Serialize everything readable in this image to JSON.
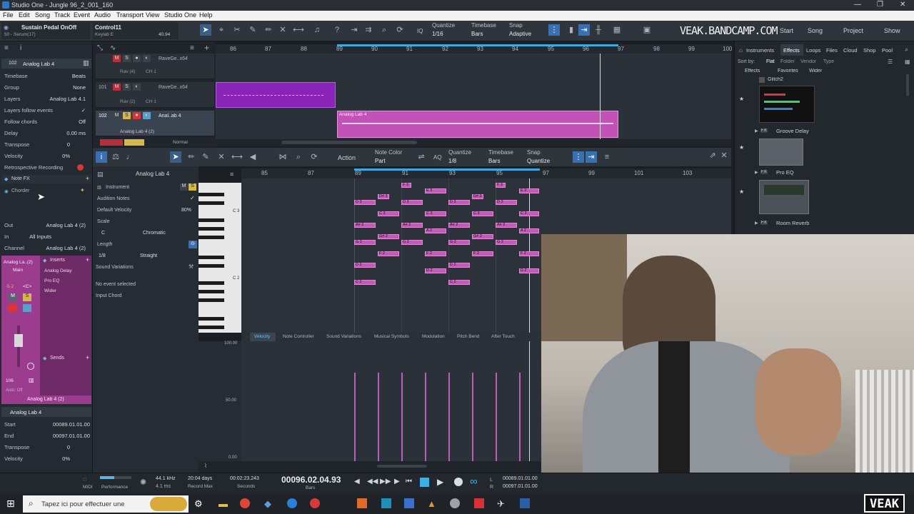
{
  "titlebar": {
    "title": "Studio One - Jungle 96_2_001_160",
    "minimize": "—",
    "maximize": "❐",
    "close": "✕"
  },
  "menu": [
    "File",
    "Edit",
    "Song",
    "Track",
    "Event",
    "Audio",
    "Transport",
    "View",
    "Studio One",
    "Help"
  ],
  "toolbar": {
    "control_a_title": "Sustain Pedal OnOff",
    "control_a_sub": "50 - Serum(17)",
    "control_b_title": "Control11",
    "control_b_sub": "Keylab E",
    "control_b_value": "40.94",
    "quantize_label": "Quantize",
    "quantize_value": "1/16",
    "timebase_label": "Timebase",
    "timebase_value": "Bars",
    "snap_label": "Snap",
    "snap_value": "Adaptive",
    "iq_label": "IQ",
    "brand": "VEAK.BANDCAMP.COM",
    "nav_start": "Start",
    "nav_song": "Song",
    "nav_project": "Project",
    "nav_show": "Show"
  },
  "inspector": {
    "track_number": "102",
    "track_name": "Analog Lab 4",
    "rows": [
      {
        "k": "Timebase",
        "v": "Beats"
      },
      {
        "k": "Group",
        "v": "None"
      },
      {
        "k": "Layers",
        "v": "Analog Lab 4.1"
      },
      {
        "k": "Layers follow events",
        "v": "✓"
      },
      {
        "k": "Follow chords",
        "v": "Off"
      },
      {
        "k": "Delay",
        "v": "0.00 ms"
      },
      {
        "k": "Transpose",
        "v": "0"
      },
      {
        "k": "Velocity",
        "v": "0%"
      },
      {
        "k": "Retrospective Recording",
        "v": ""
      }
    ],
    "note_fx_label": "Note FX",
    "chorder_label": "Chorder",
    "io_rows": [
      {
        "k": "Out",
        "v": "Analog Lab 4 (2)"
      },
      {
        "k": "In",
        "v": "All Inputs"
      },
      {
        "k": "Channel",
        "v": "Analog Lab 4 (2)"
      }
    ],
    "channel_name": "Analog La..(2)",
    "channel_main": "Main",
    "inserts_label": "Inserts",
    "inserts": [
      "Analog Delay",
      "Pro EQ",
      "Wider"
    ],
    "sends_label": "Sends",
    "vol_value": "-5.2",
    "pan_value": "<C>",
    "fader_value": "106",
    "auto_label": "Auto: Off",
    "channel_bottom_name": "Analog Lab 4 (2)",
    "event_name": "Analog Lab 4",
    "event_rows": [
      {
        "k": "Start",
        "v": "00089.01.01.00"
      },
      {
        "k": "End",
        "v": "00097.01.01.00"
      },
      {
        "k": "Transpose",
        "v": "0"
      },
      {
        "k": "Velocity",
        "v": "0%"
      }
    ]
  },
  "arrange": {
    "ruler": [
      "86",
      "87",
      "88",
      "89",
      "90",
      "91",
      "92",
      "93",
      "94",
      "95",
      "96",
      "97",
      "98",
      "99",
      "100"
    ],
    "tracks": [
      {
        "num": "",
        "name": "RaveGe..x64",
        "sub": "Rav (4)",
        "ch": "CH 1"
      },
      {
        "num": "101",
        "name": "RaveGe..x64",
        "sub": "Rav (2)",
        "ch": "CH 1"
      },
      {
        "num": "102",
        "name": "Anal..ab 4",
        "sub": "Analog Lab 4 (2)",
        "ch": ""
      }
    ],
    "clip_name": "Analog Lab 4",
    "footer_mode": "Normal"
  },
  "editor": {
    "action_label": "Action",
    "note_color_label": "Note Color",
    "note_color_value": "Part",
    "quantize_label": "Quantize",
    "quantize_value": "1/8",
    "timebase_label": "Timebase",
    "timebase_value": "Bars",
    "snap_label": "Snap",
    "snap_value": "Quantize",
    "aq_label": "AQ",
    "instrument_title": "Analog Lab 4",
    "instrument_label": "Instrument",
    "audition_label": "Audition Notes",
    "default_velocity_label": "Default Velocity",
    "default_velocity_value": "80%",
    "scale_label": "Scale",
    "scale_root": "C",
    "scale_type": "Chromatic",
    "length_label": "Length",
    "length_value": "1/8",
    "length_mode": "Straight",
    "sound_variations_label": "Sound Variations",
    "no_event_label": "No event selected",
    "input_chord_label": "Input Chord",
    "ruler": [
      "85",
      "87",
      "89",
      "91",
      "93",
      "95",
      "97",
      "99",
      "101",
      "103"
    ],
    "key_c3": "C 3",
    "key_c2": "C 2",
    "tabs": [
      "Velocity",
      "Note Controller",
      "Sound Variations",
      "Musical Symbols",
      "Modulation",
      "Pitch Bend",
      "After Touch"
    ],
    "vel_top": "100.00",
    "vel_mid": "50.00",
    "vel_bot": "0.00",
    "notes": [
      "F 3",
      "E 3",
      "D 3",
      "C 3",
      "A# 2",
      "A 2",
      "G# 2",
      "G 2",
      "F 2",
      "E 2",
      "D 2",
      "C 2",
      "D# 2",
      "D# 3"
    ]
  },
  "browser": {
    "tabs": [
      "Instruments",
      "Effects",
      "Loops",
      "Files",
      "Cloud",
      "Shop",
      "Pool"
    ],
    "sort_label": "Sort by:",
    "sort_options": [
      "Flat",
      "Folder",
      "Vendor",
      "Type"
    ],
    "path": [
      "Effects",
      "Favorites",
      "Wider"
    ],
    "items": [
      "Glitch2",
      "Groove Delay",
      "Pro EQ",
      "Room Reverb"
    ],
    "fx_badge": "FX"
  },
  "transport": {
    "midi_label": "MIDI",
    "performance_label": "Performance",
    "sample_rate": "44.1 kHz",
    "latency": "4.1 ms",
    "record_days": "20:04 days",
    "record_max": "Record Max",
    "seconds_value": "00:02:23.243",
    "seconds_label": "Seconds",
    "position": "00096.02.04.93",
    "bars_label": "Bars",
    "loop_left": "00089.01.01.00",
    "loop_right": "00097.01.01.00",
    "loop_l": "L",
    "loop_r": "R"
  },
  "taskbar": {
    "search_placeholder": "Tapez ici pour effectuer une"
  },
  "webcam": {
    "logo": "VEAK"
  }
}
